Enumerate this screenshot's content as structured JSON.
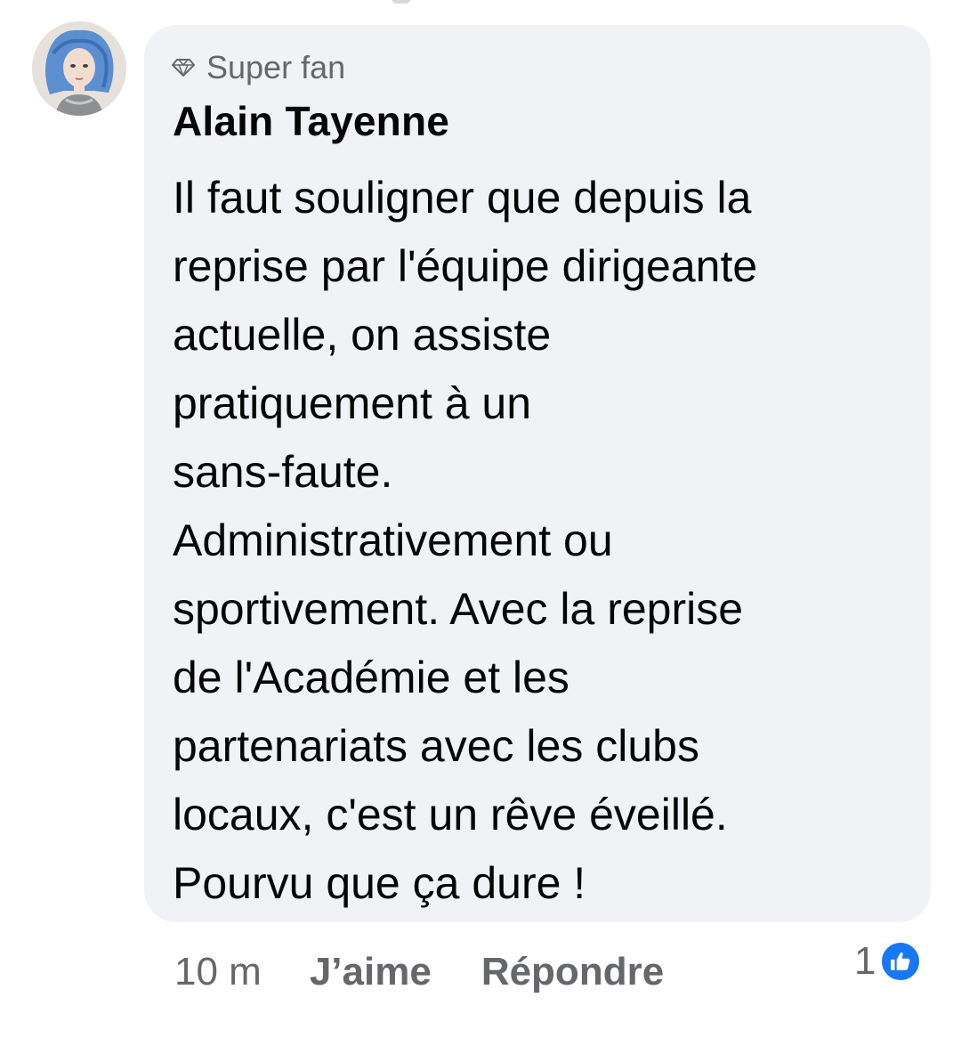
{
  "comment": {
    "badge": "Super fan",
    "badge_icon": "diamond-icon",
    "author": "Alain Tayenne",
    "text_lines": [
      "Il faut souligner que depuis la",
      "reprise par l'équipe dirigeante",
      "actuelle, on assiste",
      "pratiquement à un",
      "sans-faute.",
      "Administrativement ou",
      "sportivement. Avec la reprise",
      "de l'Académie et les",
      "partenariats avec les clubs",
      "locaux, c'est un rêve éveillé.",
      "Pourvu que ça dure !"
    ]
  },
  "actions": {
    "time": "10 m",
    "like_label": "J’aime",
    "reply_label": "Répondre"
  },
  "reactions": {
    "count": "1",
    "icon": "thumbs-up-icon",
    "color": "#1877f2"
  },
  "colors": {
    "bubble": "#f0f2f5",
    "secondary_text": "#65676b",
    "primary_text": "#050505"
  }
}
